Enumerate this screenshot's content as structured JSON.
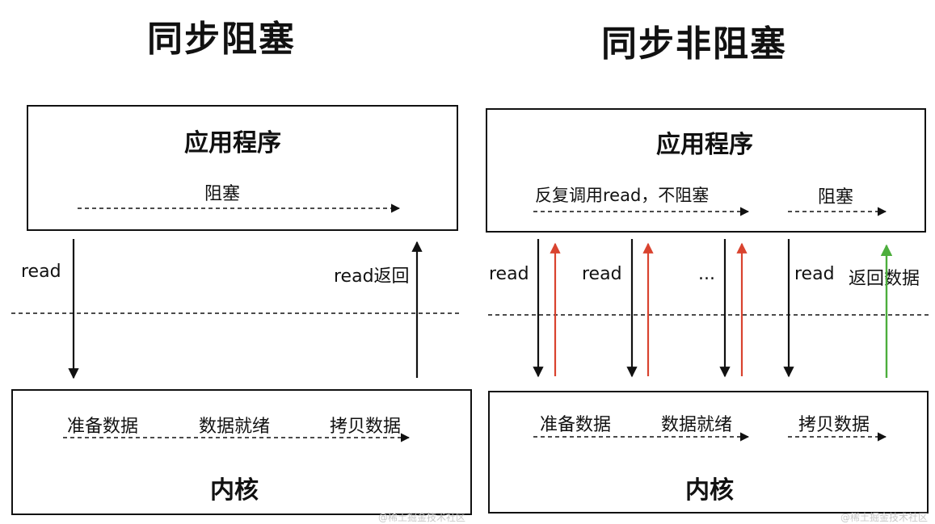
{
  "left": {
    "title": "同步阻塞",
    "app_box_title": "应用程序",
    "app_block_label": "阻塞",
    "call_label": "read",
    "return_label": "read返回",
    "kernel_steps": [
      "准备数据",
      "数据就绪",
      "拷贝数据"
    ],
    "kernel_box_title": "内核",
    "watermark": "@稀土掘金技术社区"
  },
  "right": {
    "title": "同步非阻塞",
    "app_box_title": "应用程序",
    "app_poll_label": "反复调用read，不阻塞",
    "app_block_label": "阻塞",
    "call_labels": [
      "read",
      "read",
      "...",
      "read"
    ],
    "return_label": "返回数据",
    "kernel_steps": [
      "准备数据",
      "数据就绪",
      "拷贝数据"
    ],
    "kernel_box_title": "内核",
    "watermark": "@稀土掘金技术社区"
  },
  "colors": {
    "line": "#111111",
    "error_return_arrow": "#d9432f",
    "data_return_arrow": "#4cae3c"
  }
}
